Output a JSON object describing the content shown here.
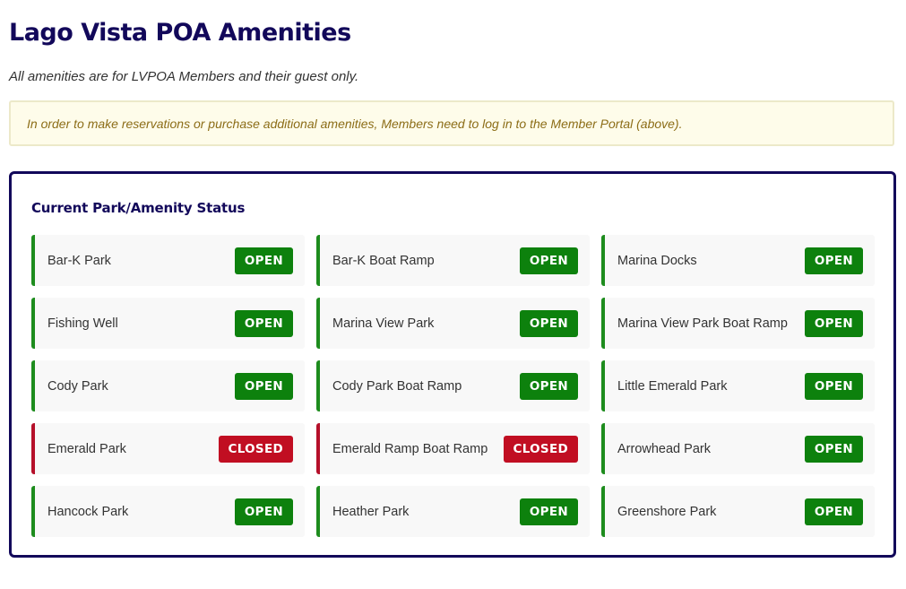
{
  "page": {
    "title": "Lago Vista POA Amenities",
    "subtitle": "All amenities are for LVPOA Members and their guest only.",
    "notice": "In order to make reservations or purchase additional amenities, Members need to log in to the Member Portal (above)."
  },
  "status_panel": {
    "title": "Current Park/Amenity Status",
    "colors": {
      "open": "#0d810d",
      "closed": "#c10e22",
      "title": "#12085a"
    },
    "amenities": [
      {
        "name": "Bar-K Park",
        "status": "OPEN"
      },
      {
        "name": "Bar-K Boat Ramp",
        "status": "OPEN"
      },
      {
        "name": "Marina Docks",
        "status": "OPEN"
      },
      {
        "name": "Fishing Well",
        "status": "OPEN"
      },
      {
        "name": "Marina View Park",
        "status": "OPEN"
      },
      {
        "name": "Marina View Park Boat Ramp",
        "status": "OPEN"
      },
      {
        "name": "Cody Park",
        "status": "OPEN"
      },
      {
        "name": "Cody Park Boat Ramp",
        "status": "OPEN"
      },
      {
        "name": "Little Emerald Park",
        "status": "OPEN"
      },
      {
        "name": "Emerald Park",
        "status": "CLOSED"
      },
      {
        "name": "Emerald Ramp Boat Ramp",
        "status": "CLOSED"
      },
      {
        "name": "Arrowhead Park",
        "status": "OPEN"
      },
      {
        "name": "Hancock Park",
        "status": "OPEN"
      },
      {
        "name": "Heather Park",
        "status": "OPEN"
      },
      {
        "name": "Greenshore Park",
        "status": "OPEN"
      }
    ]
  }
}
